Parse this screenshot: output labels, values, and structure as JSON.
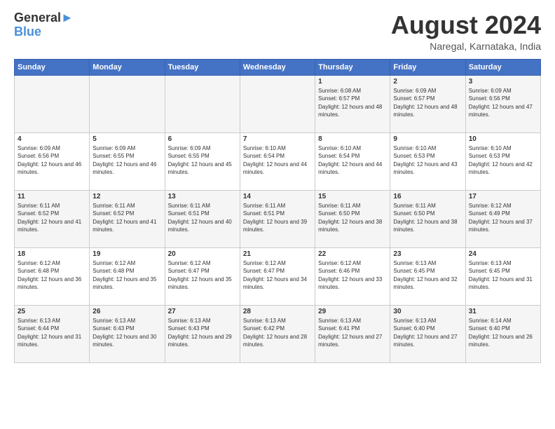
{
  "header": {
    "logo_line1": "General",
    "logo_line2": "Blue",
    "month": "August 2024",
    "location": "Naregal, Karnataka, India"
  },
  "weekdays": [
    "Sunday",
    "Monday",
    "Tuesday",
    "Wednesday",
    "Thursday",
    "Friday",
    "Saturday"
  ],
  "weeks": [
    [
      {
        "day": "",
        "sunrise": "",
        "sunset": "",
        "daylight": ""
      },
      {
        "day": "",
        "sunrise": "",
        "sunset": "",
        "daylight": ""
      },
      {
        "day": "",
        "sunrise": "",
        "sunset": "",
        "daylight": ""
      },
      {
        "day": "",
        "sunrise": "",
        "sunset": "",
        "daylight": ""
      },
      {
        "day": "1",
        "sunrise": "Sunrise: 6:08 AM",
        "sunset": "Sunset: 6:57 PM",
        "daylight": "Daylight: 12 hours and 48 minutes."
      },
      {
        "day": "2",
        "sunrise": "Sunrise: 6:09 AM",
        "sunset": "Sunset: 6:57 PM",
        "daylight": "Daylight: 12 hours and 48 minutes."
      },
      {
        "day": "3",
        "sunrise": "Sunrise: 6:09 AM",
        "sunset": "Sunset: 6:56 PM",
        "daylight": "Daylight: 12 hours and 47 minutes."
      }
    ],
    [
      {
        "day": "4",
        "sunrise": "Sunrise: 6:09 AM",
        "sunset": "Sunset: 6:56 PM",
        "daylight": "Daylight: 12 hours and 46 minutes."
      },
      {
        "day": "5",
        "sunrise": "Sunrise: 6:09 AM",
        "sunset": "Sunset: 6:55 PM",
        "daylight": "Daylight: 12 hours and 46 minutes."
      },
      {
        "day": "6",
        "sunrise": "Sunrise: 6:09 AM",
        "sunset": "Sunset: 6:55 PM",
        "daylight": "Daylight: 12 hours and 45 minutes."
      },
      {
        "day": "7",
        "sunrise": "Sunrise: 6:10 AM",
        "sunset": "Sunset: 6:54 PM",
        "daylight": "Daylight: 12 hours and 44 minutes."
      },
      {
        "day": "8",
        "sunrise": "Sunrise: 6:10 AM",
        "sunset": "Sunset: 6:54 PM",
        "daylight": "Daylight: 12 hours and 44 minutes."
      },
      {
        "day": "9",
        "sunrise": "Sunrise: 6:10 AM",
        "sunset": "Sunset: 6:53 PM",
        "daylight": "Daylight: 12 hours and 43 minutes."
      },
      {
        "day": "10",
        "sunrise": "Sunrise: 6:10 AM",
        "sunset": "Sunset: 6:53 PM",
        "daylight": "Daylight: 12 hours and 42 minutes."
      }
    ],
    [
      {
        "day": "11",
        "sunrise": "Sunrise: 6:11 AM",
        "sunset": "Sunset: 6:52 PM",
        "daylight": "Daylight: 12 hours and 41 minutes."
      },
      {
        "day": "12",
        "sunrise": "Sunrise: 6:11 AM",
        "sunset": "Sunset: 6:52 PM",
        "daylight": "Daylight: 12 hours and 41 minutes."
      },
      {
        "day": "13",
        "sunrise": "Sunrise: 6:11 AM",
        "sunset": "Sunset: 6:51 PM",
        "daylight": "Daylight: 12 hours and 40 minutes."
      },
      {
        "day": "14",
        "sunrise": "Sunrise: 6:11 AM",
        "sunset": "Sunset: 6:51 PM",
        "daylight": "Daylight: 12 hours and 39 minutes."
      },
      {
        "day": "15",
        "sunrise": "Sunrise: 6:11 AM",
        "sunset": "Sunset: 6:50 PM",
        "daylight": "Daylight: 12 hours and 38 minutes."
      },
      {
        "day": "16",
        "sunrise": "Sunrise: 6:11 AM",
        "sunset": "Sunset: 6:50 PM",
        "daylight": "Daylight: 12 hours and 38 minutes."
      },
      {
        "day": "17",
        "sunrise": "Sunrise: 6:12 AM",
        "sunset": "Sunset: 6:49 PM",
        "daylight": "Daylight: 12 hours and 37 minutes."
      }
    ],
    [
      {
        "day": "18",
        "sunrise": "Sunrise: 6:12 AM",
        "sunset": "Sunset: 6:48 PM",
        "daylight": "Daylight: 12 hours and 36 minutes."
      },
      {
        "day": "19",
        "sunrise": "Sunrise: 6:12 AM",
        "sunset": "Sunset: 6:48 PM",
        "daylight": "Daylight: 12 hours and 35 minutes."
      },
      {
        "day": "20",
        "sunrise": "Sunrise: 6:12 AM",
        "sunset": "Sunset: 6:47 PM",
        "daylight": "Daylight: 12 hours and 35 minutes."
      },
      {
        "day": "21",
        "sunrise": "Sunrise: 6:12 AM",
        "sunset": "Sunset: 6:47 PM",
        "daylight": "Daylight: 12 hours and 34 minutes."
      },
      {
        "day": "22",
        "sunrise": "Sunrise: 6:12 AM",
        "sunset": "Sunset: 6:46 PM",
        "daylight": "Daylight: 12 hours and 33 minutes."
      },
      {
        "day": "23",
        "sunrise": "Sunrise: 6:13 AM",
        "sunset": "Sunset: 6:45 PM",
        "daylight": "Daylight: 12 hours and 32 minutes."
      },
      {
        "day": "24",
        "sunrise": "Sunrise: 6:13 AM",
        "sunset": "Sunset: 6:45 PM",
        "daylight": "Daylight: 12 hours and 31 minutes."
      }
    ],
    [
      {
        "day": "25",
        "sunrise": "Sunrise: 6:13 AM",
        "sunset": "Sunset: 6:44 PM",
        "daylight": "Daylight: 12 hours and 31 minutes."
      },
      {
        "day": "26",
        "sunrise": "Sunrise: 6:13 AM",
        "sunset": "Sunset: 6:43 PM",
        "daylight": "Daylight: 12 hours and 30 minutes."
      },
      {
        "day": "27",
        "sunrise": "Sunrise: 6:13 AM",
        "sunset": "Sunset: 6:43 PM",
        "daylight": "Daylight: 12 hours and 29 minutes."
      },
      {
        "day": "28",
        "sunrise": "Sunrise: 6:13 AM",
        "sunset": "Sunset: 6:42 PM",
        "daylight": "Daylight: 12 hours and 28 minutes."
      },
      {
        "day": "29",
        "sunrise": "Sunrise: 6:13 AM",
        "sunset": "Sunset: 6:41 PM",
        "daylight": "Daylight: 12 hours and 27 minutes."
      },
      {
        "day": "30",
        "sunrise": "Sunrise: 6:13 AM",
        "sunset": "Sunset: 6:40 PM",
        "daylight": "Daylight: 12 hours and 27 minutes."
      },
      {
        "day": "31",
        "sunrise": "Sunrise: 6:14 AM",
        "sunset": "Sunset: 6:40 PM",
        "daylight": "Daylight: 12 hours and 26 minutes."
      }
    ]
  ]
}
